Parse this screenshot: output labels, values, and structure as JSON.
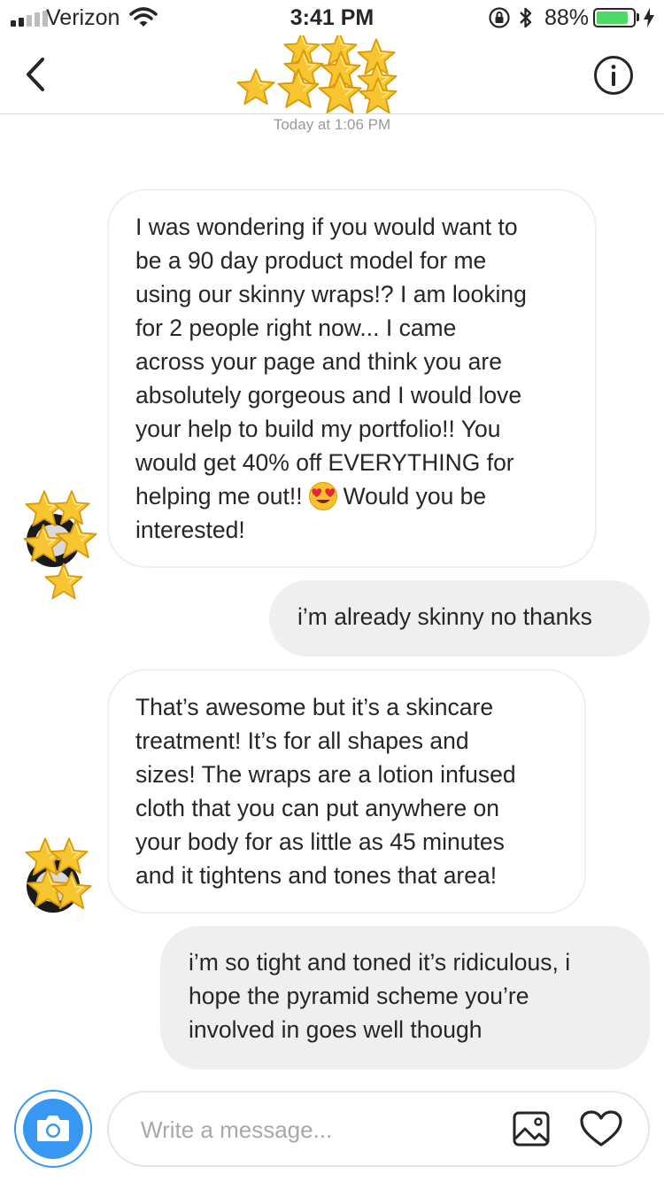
{
  "status_bar": {
    "carrier": "Verizon",
    "time": "3:41 PM",
    "battery_percent": "88%",
    "battery_level": 0.88,
    "icons": [
      "signal-icon",
      "wifi-icon",
      "orientation-lock-icon",
      "bluetooth-icon",
      "battery-icon",
      "charging-icon"
    ]
  },
  "header": {
    "back_icon": "chevron-left-icon",
    "title_icon": "star-emoji-cluster",
    "info_icon": "info-icon",
    "timestamp": "Today at 1:06 PM"
  },
  "messages": [
    {
      "direction": "incoming",
      "lines": [
        "I was wondering if you would want to",
        "be a 90 day product model for me",
        "using our skinny wraps!? I am looking",
        "for 2 people right now... I came",
        "across your page and think you are",
        "absolutely gorgeous and I would love",
        "your help to build my portfolio!! You",
        "would get 40% off EVERYTHING for",
        "helping me out!!",
        "Would you be",
        "interested!"
      ],
      "emoji": "heart-eyes-emoji"
    },
    {
      "direction": "outgoing",
      "lines": [
        "i’m already skinny no thanks"
      ]
    },
    {
      "direction": "incoming",
      "lines": [
        "That’s awesome but it’s a skincare",
        "treatment! It’s for all shapes and",
        "sizes! The wraps are a lotion infused",
        "cloth that you can put anywhere on",
        "your body for as little as 45 minutes",
        "and it tightens and tones that area!"
      ]
    },
    {
      "direction": "outgoing",
      "lines": [
        "i’m so tight and toned it’s ridiculous, i",
        "hope the pyramid scheme you’re",
        "involved in goes well though"
      ]
    }
  ],
  "composer": {
    "placeholder": "Write a message...",
    "camera_icon": "camera-icon",
    "gallery_icon": "image-icon",
    "like_icon": "heart-icon"
  },
  "colors": {
    "accent": "#3897f0",
    "incoming_bubble_border": "#efefef",
    "outgoing_bubble": "#efefef",
    "text": "#262626",
    "muted": "#999999",
    "battery": "#4cd964",
    "star": "#f5c518"
  }
}
